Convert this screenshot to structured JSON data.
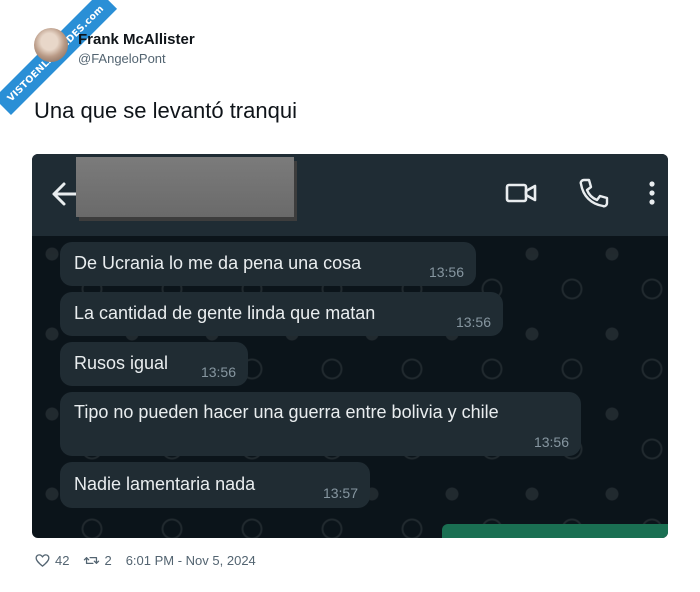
{
  "watermark": {
    "text": "VISTOENLASREDES",
    "suffix": ".com"
  },
  "author": {
    "name": "Frank McAllister",
    "handle": "@FAngeloPont"
  },
  "tweet": {
    "text": "Una que se levantó tranqui"
  },
  "chat": {
    "messages": [
      {
        "text": "De Ucrania lo me da pena una cosa",
        "time": "13:56"
      },
      {
        "text": "La cantidad de gente linda que matan",
        "time": "13:56"
      },
      {
        "text": "Rusos igual",
        "time": "13:56"
      },
      {
        "text": "Tipo no pueden hacer una guerra entre bolivia y chile",
        "time": "13:56"
      },
      {
        "text": "Nadie lamentaria nada",
        "time": "13:57"
      }
    ],
    "icons": {
      "back": "arrow-left-icon",
      "video": "video-call-icon",
      "call": "phone-icon",
      "more": "more-vertical-icon"
    }
  },
  "footer": {
    "likes": "42",
    "retweets": "2",
    "timestamp": "6:01 PM - Nov 5, 2024"
  },
  "colors": {
    "chat_bg": "#0b141a",
    "bubble": "#202c33",
    "header": "#1f2c34",
    "ribbon": "#2a8fd6"
  }
}
